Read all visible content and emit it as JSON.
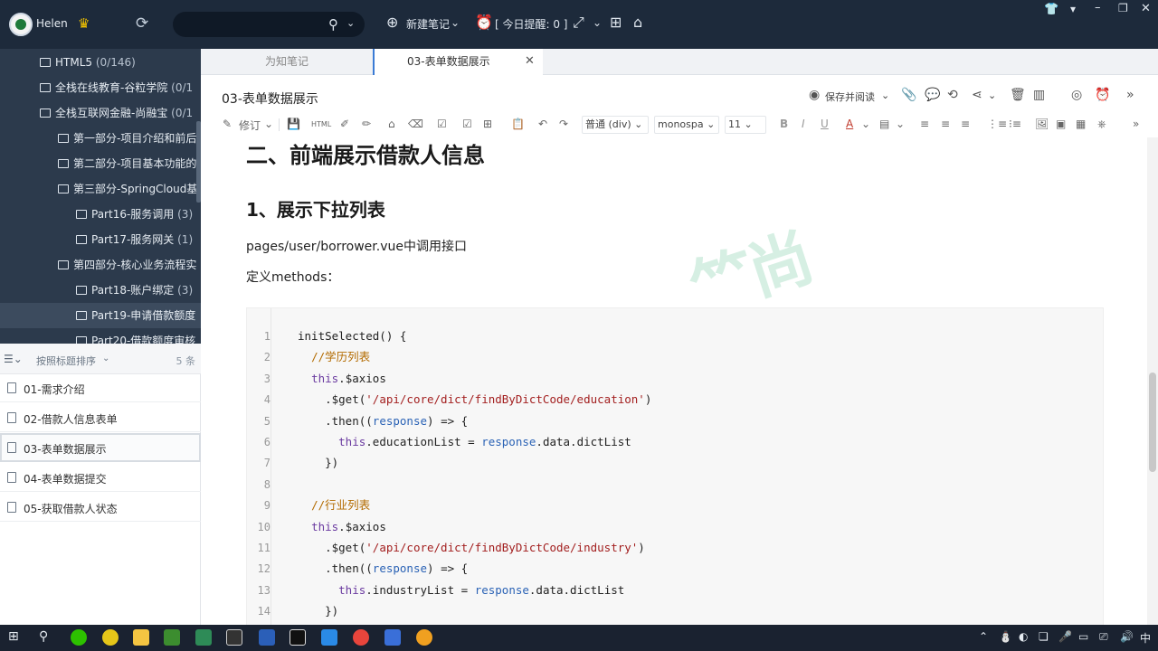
{
  "topbar": {
    "username": "Helen",
    "new_note": "新建笔记",
    "reminder": "[ 今日提醒: 0 ]",
    "search_value": "",
    "icons": [
      "avatar",
      "crown-icon",
      "sync-icon",
      "search-icon",
      "add-icon",
      "alarm-icon",
      "expand-icon",
      "grid-icon",
      "home-icon",
      "skin-icon",
      "menu-icon",
      "minimize-icon",
      "restore-icon",
      "close-icon"
    ]
  },
  "tree": {
    "items": [
      {
        "label": "HTML5",
        "count": "(0/146)"
      },
      {
        "label": "全栈在线教育-谷粒学院",
        "count": "(0/1"
      },
      {
        "label": "全栈互联网金融-尚融宝",
        "count": "(0/1"
      },
      {
        "label": "第一部分-项目介绍和前后",
        "count": ""
      },
      {
        "label": "第二部分-项目基本功能的",
        "count": ""
      },
      {
        "label": "第三部分-SpringCloud基",
        "count": ""
      },
      {
        "label": "Part16-服务调用",
        "count": "(3)"
      },
      {
        "label": "Part17-服务网关",
        "count": "(1)"
      },
      {
        "label": "第四部分-核心业务流程实",
        "count": ""
      },
      {
        "label": "Part18-账户绑定",
        "count": "(3)"
      },
      {
        "label": "Part19-申请借款额度",
        "count": ""
      },
      {
        "label": "Part20-借款额度审核",
        "count": ""
      }
    ]
  },
  "notes": {
    "sort_label": "按照标题排序",
    "count": "5 条",
    "items": [
      {
        "title": "01-需求介绍"
      },
      {
        "title": "02-借款人信息表单"
      },
      {
        "title": "03-表单数据展示"
      },
      {
        "title": "04-表单数据提交"
      },
      {
        "title": "05-获取借款人状态"
      }
    ]
  },
  "tabs": [
    {
      "label": "为知笔记"
    },
    {
      "label": "03-表单数据展示"
    }
  ],
  "doc": {
    "title": "03-表单数据展示",
    "save_read": "保存并阅读",
    "toolbar": {
      "revise": "修订",
      "html": "HTML",
      "style_select": "普通 (div)",
      "font_select": "monospa",
      "size_select": "11"
    },
    "h2": "二、前端展示借款人信息",
    "h3": "1、展示下拉列表",
    "para1": "pages/user/borrower.vue中调用接口",
    "para2": "定义methods："
  },
  "code": {
    "lines": [
      {
        "n": "1",
        "segs": [
          [
            "pl",
            "initSelected() {"
          ]
        ]
      },
      {
        "n": "2",
        "segs": [
          [
            "pl",
            "  "
          ],
          [
            "cm",
            "//学历列表"
          ]
        ]
      },
      {
        "n": "3",
        "segs": [
          [
            "pl",
            "  "
          ],
          [
            "kw",
            "this"
          ],
          [
            "pl",
            ".$axios"
          ]
        ]
      },
      {
        "n": "4",
        "segs": [
          [
            "pl",
            "    .$get("
          ],
          [
            "st",
            "'/api/core/dict/findByDictCode/education'"
          ],
          [
            "pl",
            ")"
          ]
        ]
      },
      {
        "n": "5",
        "segs": [
          [
            "pl",
            "    .then(("
          ],
          [
            "pm",
            "response"
          ],
          [
            "pl",
            ") => {"
          ]
        ]
      },
      {
        "n": "6",
        "segs": [
          [
            "pl",
            "      "
          ],
          [
            "kw",
            "this"
          ],
          [
            "pl",
            ".educationList = "
          ],
          [
            "pm",
            "response"
          ],
          [
            "pl",
            ".data.dictList"
          ]
        ]
      },
      {
        "n": "7",
        "segs": [
          [
            "pl",
            "    })"
          ]
        ]
      },
      {
        "n": "8",
        "segs": [
          [
            "pl",
            ""
          ]
        ]
      },
      {
        "n": "9",
        "segs": [
          [
            "pl",
            "  "
          ],
          [
            "cm",
            "//行业列表"
          ]
        ]
      },
      {
        "n": "10",
        "segs": [
          [
            "pl",
            "  "
          ],
          [
            "kw",
            "this"
          ],
          [
            "pl",
            ".$axios"
          ]
        ]
      },
      {
        "n": "11",
        "segs": [
          [
            "pl",
            "    .$get("
          ],
          [
            "st",
            "'/api/core/dict/findByDictCode/industry'"
          ],
          [
            "pl",
            ")"
          ]
        ]
      },
      {
        "n": "12",
        "segs": [
          [
            "pl",
            "    .then(("
          ],
          [
            "pm",
            "response"
          ],
          [
            "pl",
            ") => {"
          ]
        ]
      },
      {
        "n": "13",
        "segs": [
          [
            "pl",
            "      "
          ],
          [
            "kw",
            "this"
          ],
          [
            "pl",
            ".industryList = "
          ],
          [
            "pm",
            "response"
          ],
          [
            "pl",
            ".data.dictList"
          ]
        ]
      },
      {
        "n": "14",
        "segs": [
          [
            "pl",
            "    })"
          ]
        ]
      }
    ]
  },
  "taskbar": {
    "ime": "中",
    "colors": {
      "wechat": "#2dc100",
      "explorer": "#f5c542",
      "vscode": "#2a8ae6",
      "chrome": "#e8453c",
      "word": "#2b5fb8"
    }
  },
  "colors": {
    "topbar_bg": "#1d2a3b",
    "tree_bg": "#2c3a4c",
    "accent_tab": "#3a7bd5",
    "code_keyword": "#6a3aa0",
    "code_comment": "#b36b00",
    "code_string": "#a32020",
    "code_param": "#2a62b5"
  }
}
